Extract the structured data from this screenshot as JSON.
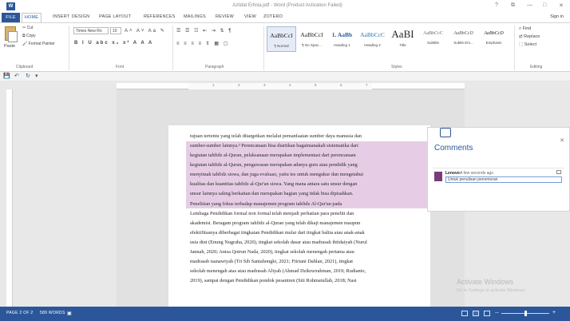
{
  "window": {
    "title": "Azlidat Erlinia.pdf - Word (Product Activation Failed)",
    "app_letter": "W",
    "controls": [
      "?",
      "⧉",
      "—",
      "□",
      "✕"
    ]
  },
  "ribbon_tabs": [
    {
      "label": "FILE"
    },
    {
      "label": "HOME"
    },
    {
      "label": "INSERT"
    },
    {
      "label": "DESIGN"
    },
    {
      "label": "PAGE LAYOUT"
    },
    {
      "label": "REFERENCES"
    },
    {
      "label": "MAILINGS"
    },
    {
      "label": "REVIEW"
    },
    {
      "label": "VIEW"
    },
    {
      "label": "ZOTERO"
    }
  ],
  "sign_in": "Sign in",
  "clipboard": {
    "paste": "Paste",
    "cut": "Cut",
    "copy": "Copy",
    "format_painter": "Format Painter",
    "label": "Clipboard"
  },
  "font": {
    "name": "Times New Ro",
    "size": "10",
    "label": "Font",
    "row1": "A˄ A˅ Aa ✎",
    "row2": "B I U abc x₂ x² A A A"
  },
  "paragraph": {
    "label": "Paragraph",
    "row1": "☰ ☰ ☷ ⇤ ⇥ ⇅ ¶",
    "row2": "≡ ≡ ≡ ≡ ⇕ ▦ ▢"
  },
  "styles": {
    "label": "Styles",
    "items": [
      {
        "preview": "AaBbCcI",
        "name": "¶ Normal"
      },
      {
        "preview": "AaBbCcI",
        "name": "¶ No Spac..."
      },
      {
        "preview": "1. AaBb",
        "name": "Heading 1"
      },
      {
        "preview": "AaBbCcC",
        "name": "Heading 2"
      },
      {
        "preview": "AaBI",
        "name": "Title"
      },
      {
        "preview": "AaBbCcC",
        "name": "Subtitle"
      },
      {
        "preview": "AaBbCcD",
        "name": "Subtle Em..."
      },
      {
        "preview": "AaBbCcD",
        "name": "Emphasis"
      }
    ]
  },
  "editing": {
    "find": "Find",
    "replace": "Replace",
    "select": "Select",
    "label": "Editing"
  },
  "quick_access": [
    "💾",
    "↶",
    "↻",
    "▾"
  ],
  "ruler_numbers": [
    "1",
    "2",
    "3",
    "4",
    "5",
    "6",
    "7"
  ],
  "document": {
    "lines": [
      "tujuan tertentu yang telah ditargetkan melalui pemanfaatan sumber daya manusia dan",
      "sumber-sumber lainnya.³ Perencanaan bisa diartikan bagaimanakah sistematika dari",
      "kegiatan tahfidz al-Quran, pelaksanaan merupakan implementasi dari perencanaan",
      "kegiatan tahfidz al-Quran, pengawasan merupakan adanya guru atau pendidik yang",
      "menyimak tahfidz siswa, dan juga evaluasi, yaitu tes untuk mengukur dan mengetahui",
      "kualitas dan kuantitas tahfidz al-Qur'an siswa. Yang mana antara satu unsur dengan",
      "unsur lainnya saling berkaitan dan merupakan bagian yang tidak bisa dipisahkan.",
      "        Penelitian yang fokus terhadap manajemen program tahfidz Al-Qur'an pada",
      "Lembaga Pendidikan formal non formal telah menjadi perhatian para peneliti dan",
      "akademisi. Beragam program tahfidz al-Quran yang telah dikaji manajemen maupun",
      "efektifitasnya diberbagai tingkatan Pendidikan mulai dari tingkat balita atau anak-anak",
      "usia dini (Enung Nugraha, 2020), tingkat sekolah dasar atau madrasah ibtidaiyah (Nurul",
      "Jannah, 2020; Anisa Qotrun Nada, 2020), tingkat sekolah menengah pertama atau",
      "madrasah tsanawiyah (Tri Sih Santahongki, 2021; Fitriani Dahlan, 2021), tingkat",
      "sekolah menengah atas atau madrasah Aliyah (Ahmad Dzikrurrahman, 2019; Rudianto,",
      "2019), sampai dengan Pendidikan pondok pesantren (Siti Rohmatullah, 2018; Nasi"
    ]
  },
  "comments": {
    "title": "Comments",
    "close": "✕",
    "author": "Lenovo",
    "time": "A few seconds ago",
    "text": "Untuk penulisan penomoran"
  },
  "watermark": {
    "title": "Activate Windows",
    "subtitle": "Go to Settings to activate Windows."
  },
  "status_bar": {
    "page": "PAGE 2 OF 2",
    "words": "589 WORDS",
    "zoom_minus": "—",
    "zoom_plus": "+"
  }
}
